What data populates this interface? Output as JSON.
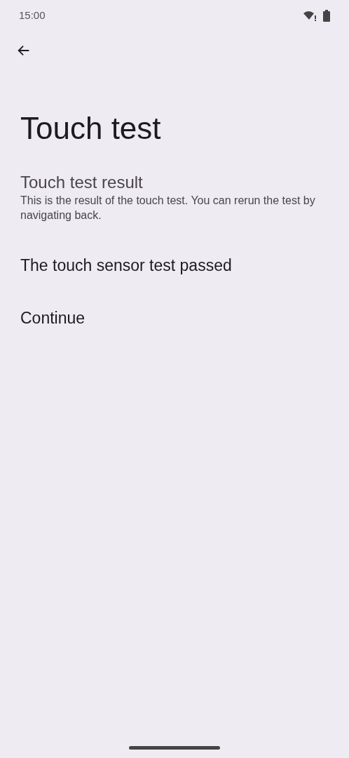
{
  "status_bar": {
    "time": "15:00"
  },
  "title": "Touch test",
  "section": {
    "title": "Touch test result",
    "description": "This is the result of the touch test. You can rerun the test by navigating back."
  },
  "result": "The touch sensor test passed",
  "action": "Continue"
}
